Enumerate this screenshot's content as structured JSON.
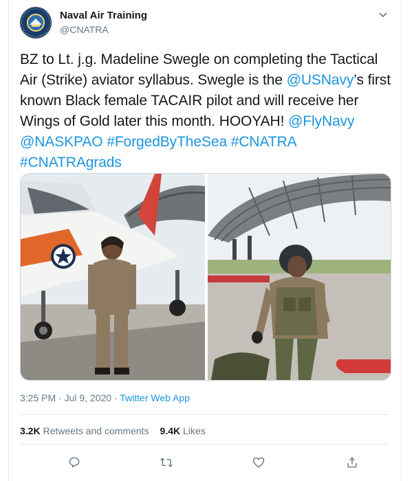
{
  "account": {
    "name": "Naval Air Training",
    "handle": "@CNATRA"
  },
  "tweet": {
    "text_1": "BZ to Lt. j.g. Madeline Swegle on completing the Tactical Air (Strike) aviator syllabus. Swegle is the ",
    "mention_usnavy": "@USNavy",
    "text_2": "’s first known Black female TACAIR pilot and will receive her Wings of Gold later this month. HOOYAH! ",
    "mention_flynavy": "@FlyNavy",
    "mention_naskpao": "@NASKPAO",
    "hashtag_forged": "#ForgedByTheSea",
    "hashtag_cnatra": "#CNATRA",
    "hashtag_cnatragrads": "#CNATRAgrads"
  },
  "meta": {
    "timestamp": "3:25 PM · Jul 9, 2020",
    "separator": " · ",
    "app": "Twitter Web App"
  },
  "stats": {
    "retweets_count": "3.2K",
    "retweets_label": "Retweets and comments",
    "likes_count": "9.4K",
    "likes_label": "Likes"
  },
  "icons": {
    "reply": "reply-icon",
    "retweet": "retweet-icon",
    "like": "heart-icon",
    "share": "share-icon",
    "more": "chevron-down-icon"
  },
  "colors": {
    "link": "#1b95e0",
    "text": "#14171a",
    "secondary": "#657786"
  }
}
